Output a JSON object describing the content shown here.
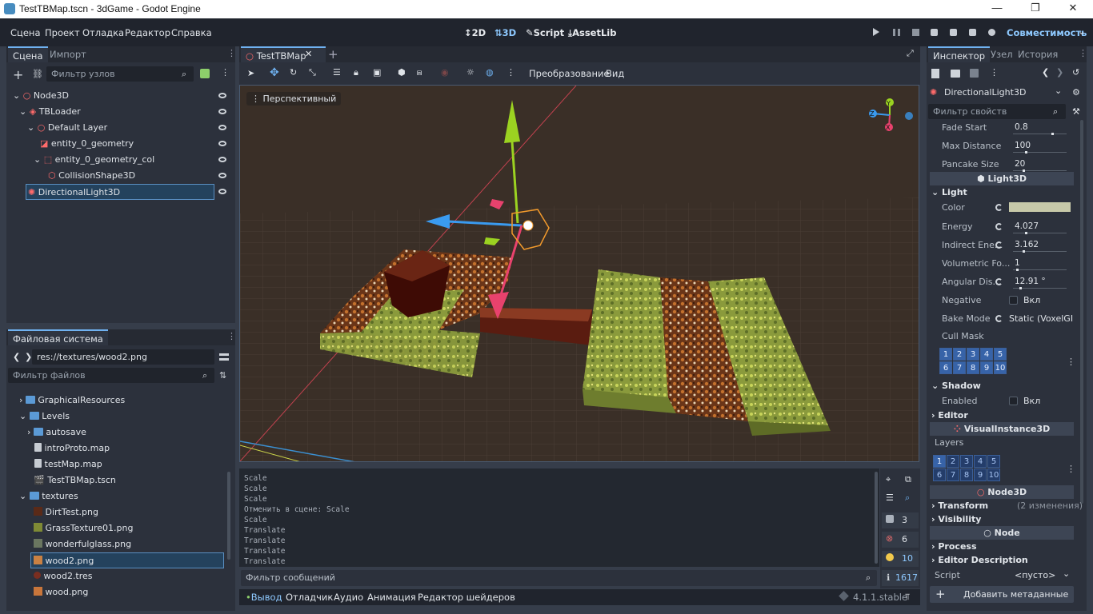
{
  "window": {
    "title": "TestTBMap.tscn - 3dGame - Godot Engine"
  },
  "menu": {
    "items": [
      "Сцена",
      "Проект",
      "Отладка",
      "Редактор",
      "Справка"
    ]
  },
  "modes": {
    "m2d": "2D",
    "m3d": "3D",
    "script": "Script",
    "assetlib": "AssetLib"
  },
  "renderer": "Совместимость",
  "scene_dock": {
    "tabs": [
      "Сцена",
      "Импорт"
    ],
    "filter_placeholder": "Фильтр узлов",
    "nodes": [
      {
        "label": "Node3D",
        "icon_color": "#ff6b6b"
      },
      {
        "label": "TBLoader",
        "icon_color": "#ff6b6b"
      },
      {
        "label": "Default Layer",
        "icon_color": "#ff6b6b"
      },
      {
        "label": "entity_0_geometry",
        "icon_color": "#ff6b6b"
      },
      {
        "label": "entity_0_geometry_col",
        "icon_color": "#ff6b6b"
      },
      {
        "label": "CollisionShape3D",
        "icon_color": "#ff6b6b"
      },
      {
        "label": "DirectionalLight3D",
        "icon_color": "#ff6b6b"
      }
    ]
  },
  "filesystem": {
    "tab": "Файловая система",
    "path": "res://textures/wood2.png",
    "filter_placeholder": "Фильтр файлов",
    "items": [
      {
        "label": "GraphicalResources",
        "kind": "folder"
      },
      {
        "label": "Levels",
        "kind": "folder"
      },
      {
        "label": "autosave",
        "kind": "folder"
      },
      {
        "label": "introProto.map",
        "kind": "file"
      },
      {
        "label": "testMap.map",
        "kind": "file"
      },
      {
        "label": "TestTBMap.tscn",
        "kind": "scene"
      },
      {
        "label": "textures",
        "kind": "folder"
      },
      {
        "label": "DirtTest.png",
        "kind": "image"
      },
      {
        "label": "GrassTexture01.png",
        "kind": "image"
      },
      {
        "label": "wonderfulglass.png",
        "kind": "image"
      },
      {
        "label": "wood2.png",
        "kind": "image"
      },
      {
        "label": "wood2.tres",
        "kind": "resource"
      },
      {
        "label": "wood.png",
        "kind": "image"
      }
    ]
  },
  "editor": {
    "scene_tab": "TestTBMap",
    "toolbar": {
      "transform": "Преобразование",
      "view": "Вид"
    },
    "viewport_label": "Перспективный"
  },
  "output": {
    "lines": [
      "Scale",
      "Scale",
      "Scale",
      "Отменить в сцене: Scale",
      "Scale",
      "Translate",
      "Translate",
      "Translate",
      "Translate"
    ],
    "filter_placeholder": "Фильтр сообщений",
    "counts": {
      "messages": "3",
      "errors": "6",
      "warnings": "10",
      "info": "1617"
    }
  },
  "bottom_tabs": [
    "Вывод",
    "Отладчик",
    "Аудио",
    "Анимация",
    "Редактор шейдеров"
  ],
  "version": "4.1.1.stable",
  "inspector": {
    "tabs": [
      "Инспектор",
      "Узел",
      "История"
    ],
    "node": "DirectionalLight3D",
    "filter_placeholder": "Фильтр свойств",
    "shadow_props": [
      {
        "label": "Fade Start",
        "value": "0.8",
        "level": 0.8
      },
      {
        "label": "Max Distance",
        "value": "100",
        "level": 0.25
      },
      {
        "label": "Pancake Size",
        "value": "20",
        "level": 0.2
      }
    ],
    "section_light3d": "Light3D",
    "group_light": "Light",
    "light_props": [
      {
        "label": "Color",
        "value": ""
      },
      {
        "label": "Energy",
        "value": "4.027",
        "level": 0.25
      },
      {
        "label": "Indirect Ene...",
        "value": "3.162",
        "level": 0.2
      },
      {
        "label": "Volumetric Fo...",
        "value": "1",
        "level": 0.06
      },
      {
        "label": "Angular Dis...",
        "value": "12.91 °",
        "level": 0.14
      }
    ],
    "light_color": "#c7c9a9",
    "negative_label": "Negative",
    "negative_value": "Вкл",
    "bake_label": "Bake Mode",
    "bake_value": "Static (VoxelGI/S",
    "cull_label": "Cull Mask",
    "grp_shadow": "Shadow",
    "enabled_label": "Enabled",
    "enabled_value": "Вкл",
    "grp_editor": "Editor",
    "section_visual": "VisualInstance3D",
    "layers_label": "Layers",
    "section_node3d": "Node3D",
    "transform_label": "Transform",
    "transform_note": "(2 изменения)",
    "visibility_label": "Visibility",
    "section_node": "Node",
    "process_label": "Process",
    "editor_desc_label": "Editor Description",
    "script_label": "Script",
    "script_value": "<пусто>",
    "add_meta": "Добавить метаданные"
  },
  "cull_mask": [
    "1",
    "2",
    "3",
    "4",
    "5",
    "6",
    "7",
    "8",
    "9",
    "10"
  ],
  "layers": [
    "1",
    "2",
    "3",
    "4",
    "5",
    "6",
    "7",
    "8",
    "9",
    "10"
  ],
  "gizmo": {
    "x": "X",
    "y": "Y",
    "z": "Z"
  }
}
